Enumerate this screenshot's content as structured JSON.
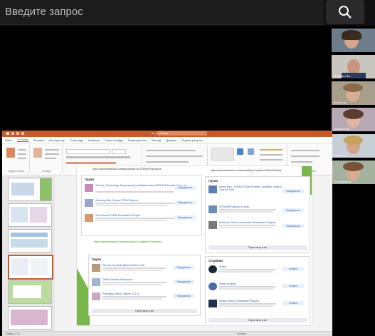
{
  "search": {
    "placeholder": "Введите запрос"
  },
  "participants": [
    {
      "name": ""
    },
    {
      "name": "Михайло Ва..."
    },
    {
      "name": "Ірина Кар..."
    },
    {
      "name": "Оксана Руд..."
    },
    {
      "name": "Людмила..."
    },
    {
      "name": "Оля Мельник..."
    }
  ],
  "ppt": {
    "title": "Ш_РАБ_сь - PowerPoint",
    "search": "Пошук",
    "tabs": [
      "Файл",
      "Основне",
      "Вставка",
      "Конструктор",
      "Переходи",
      "Анімація",
      "Показ слайдів",
      "Рецензування",
      "Вигляд",
      "Довідка",
      "Формат рисунка"
    ],
    "active_tab": 1,
    "ribbon_groups": [
      "Буфер обміну",
      "Слайди",
      "Шрифт",
      "Абзац",
      "Креслення",
      "Редагування"
    ],
    "status_left": "Слайд 4 з 12",
    "status_notes": "Нотатки",
    "status_zoom": "",
    "slide": {
      "url_top_left": "https://www.facebook.com/search/top/?q=STEM%20projects",
      "url_top_right": "https://www.facebook.com/search/top/?q=stem%20for%20kids",
      "url_middle": "https://www.facebook.com/search/top/?q=gifted%20children",
      "left_group": {
        "title": "Групи",
        "items": [
          {
            "title": "Science, Technology, Engineering, and Mathematics (STEM) Education Projects",
            "btn": "Приєднатися"
          },
          {
            "title": "Amazing After-School STEM Projects",
            "btn": "Приєднатися"
          },
          {
            "title": "The Arizona STEM Acceleration Project",
            "btn": "Приєднатися"
          }
        ]
      },
      "right_group": {
        "title": "Групи",
        "items": [
          {
            "title": "Smart Kids - STEM/STEAM Projects, Activities, Ideas & Toys for Kids",
            "btn": "Приєднатися"
          },
          {
            "title": "STEA(M) Projects for Kids",
            "btn": "Приєднатися"
          },
          {
            "title": "American Steam Locomotive Restoration Projects",
            "btn": "Приєднатися"
          }
        ],
        "more": "Переглянути всі"
      },
      "gifted_group": {
        "title": "Групи",
        "items": [
          {
            "title": "Parents of (adult) gifted children USA",
            "btn": "Приєднатися"
          },
          {
            "title": "Gifted Children Resources",
            "btn": "Приєднатися"
          },
          {
            "title": "Parenting Gifted Children (5-12)",
            "btn": "Приєднатися"
          }
        ],
        "more": "Переглянути всі"
      },
      "pages_group": {
        "title": "Сторінки",
        "items": [
          {
            "title": "Steam",
            "btn": "Стежити"
          },
          {
            "title": "Steam projects",
            "btn": "Стежити"
          },
          {
            "title": "Steam Deals & Kickstarter Projects",
            "btn": "Стежити"
          }
        ],
        "more": "Переглянути всі"
      }
    }
  },
  "colors": {
    "accent": "#c55a2b",
    "link": "#2b5fa8",
    "green": "#6aa53b"
  }
}
